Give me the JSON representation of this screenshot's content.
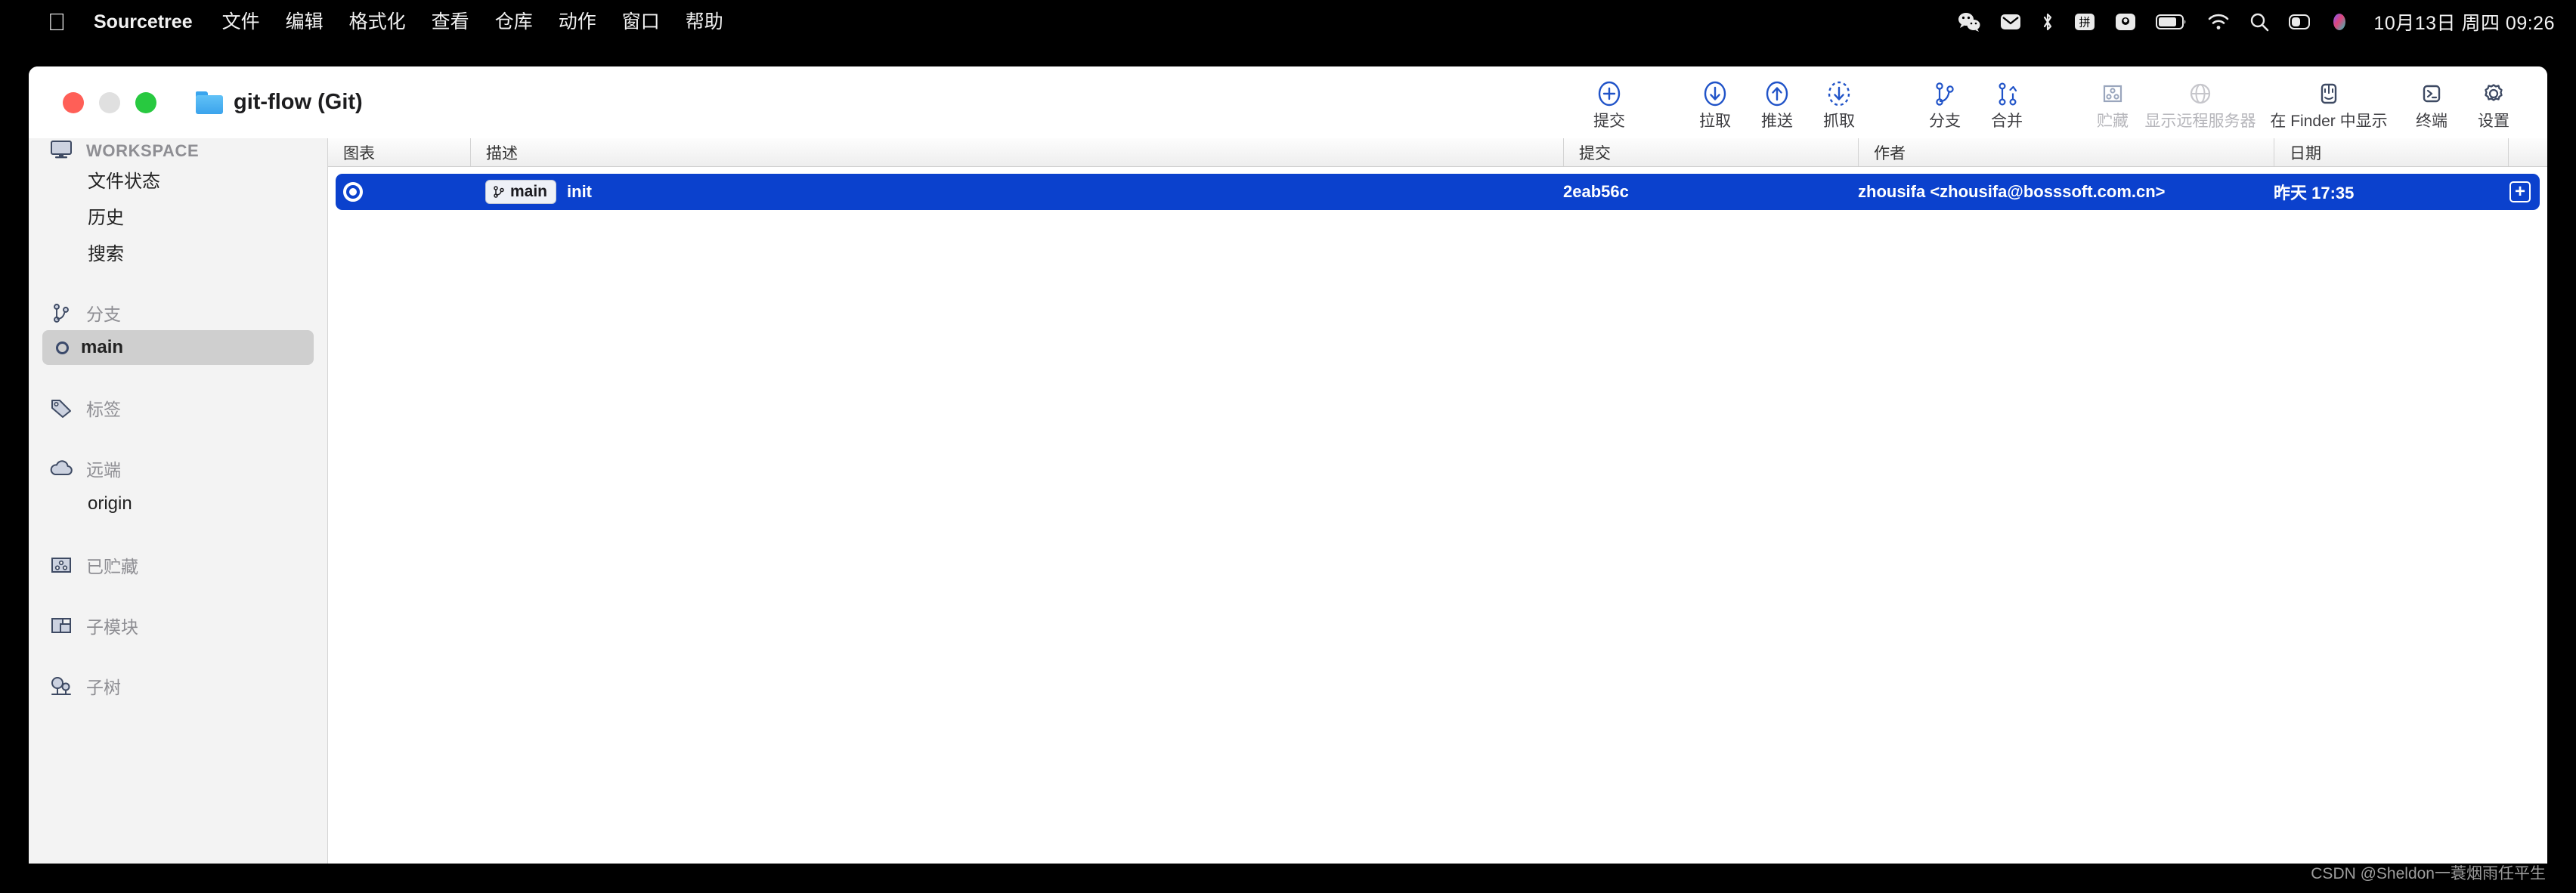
{
  "menubar": {
    "apple_icon": "apple-logo-icon",
    "app_name": "Sourcetree",
    "items": [
      "文件",
      "编辑",
      "格式化",
      "查看",
      "仓库",
      "动作",
      "窗口",
      "帮助"
    ],
    "status_icons": [
      "wechat-icon",
      "mail-icon",
      "bluetooth-icon",
      "input-method-pinyin-icon",
      "screenshot-icon",
      "battery-icon",
      "wifi-icon",
      "search-icon",
      "control-center-icon",
      "siri-icon"
    ],
    "clock": "10月13日 周四  09:26"
  },
  "window": {
    "title": "git-flow (Git)",
    "folder_icon": "folder-icon",
    "traffic_lights": [
      "close-button",
      "minimize-button",
      "maximize-button"
    ]
  },
  "toolbar": {
    "buttons": [
      {
        "label": "提交",
        "icon": "commit-plus-circle-icon",
        "enabled": true
      },
      {
        "label": "拉取",
        "icon": "pull-down-arrow-circle-icon",
        "enabled": true
      },
      {
        "label": "推送",
        "icon": "push-up-arrow-circle-icon",
        "enabled": true
      },
      {
        "label": "抓取",
        "icon": "fetch-dashed-circle-icon",
        "enabled": true
      },
      {
        "label": "分支",
        "icon": "branch-icon",
        "enabled": true
      },
      {
        "label": "合并",
        "icon": "merge-icon",
        "enabled": true
      },
      {
        "label": "贮藏",
        "icon": "stash-box-icon",
        "enabled": false
      },
      {
        "label": "显示远程服务器",
        "icon": "globe-remote-icon",
        "enabled": false
      },
      {
        "label": "在 Finder 中显示",
        "icon": "finder-icon",
        "enabled": true
      },
      {
        "label": "终端",
        "icon": "terminal-icon",
        "enabled": true
      },
      {
        "label": "设置",
        "icon": "gear-icon",
        "enabled": true
      }
    ]
  },
  "sidebar": {
    "workspace": {
      "label": "WORKSPACE",
      "icon": "monitor-icon"
    },
    "workspace_items": [
      "文件状态",
      "历史",
      "搜索"
    ],
    "branches": {
      "label": "分支",
      "icon": "branch-icon"
    },
    "branch_items": [
      {
        "label": "main",
        "selected": true
      }
    ],
    "tags": {
      "label": "标签",
      "icon": "tag-icon"
    },
    "remotes": {
      "label": "远端",
      "icon": "cloud-icon"
    },
    "remote_items": [
      "origin"
    ],
    "stashes": {
      "label": "已贮藏",
      "icon": "stash-box-icon"
    },
    "submodules": {
      "label": "子模块",
      "icon": "submodule-icon"
    },
    "subtrees": {
      "label": "子树",
      "icon": "subtree-icon"
    }
  },
  "commit_table": {
    "headers": {
      "graph": "图表",
      "description": "描述",
      "commit": "提交",
      "author": "作者",
      "date": "日期"
    },
    "rows": [
      {
        "node_icon": "commit-node-icon",
        "branch_badge": "main",
        "branch_badge_icon": "branch-icon",
        "description": "init",
        "commit": "2eab56c",
        "author": "zhousifa <zhousifa@bosssoft.com.cn>",
        "date": "昨天 17:35",
        "expand_label": "+",
        "selected": true
      }
    ]
  },
  "watermark": "CSDN @Sheldon一蓑烟雨任平生",
  "colors": {
    "selection_blue": "#0b41cd",
    "accent_blue": "#2053c8",
    "sidebar_bg": "#f3f3f3",
    "menubar_bg": "#000000",
    "traffic_close": "#ff5f57",
    "traffic_min": "#e0e0e0",
    "traffic_max": "#28c940"
  }
}
